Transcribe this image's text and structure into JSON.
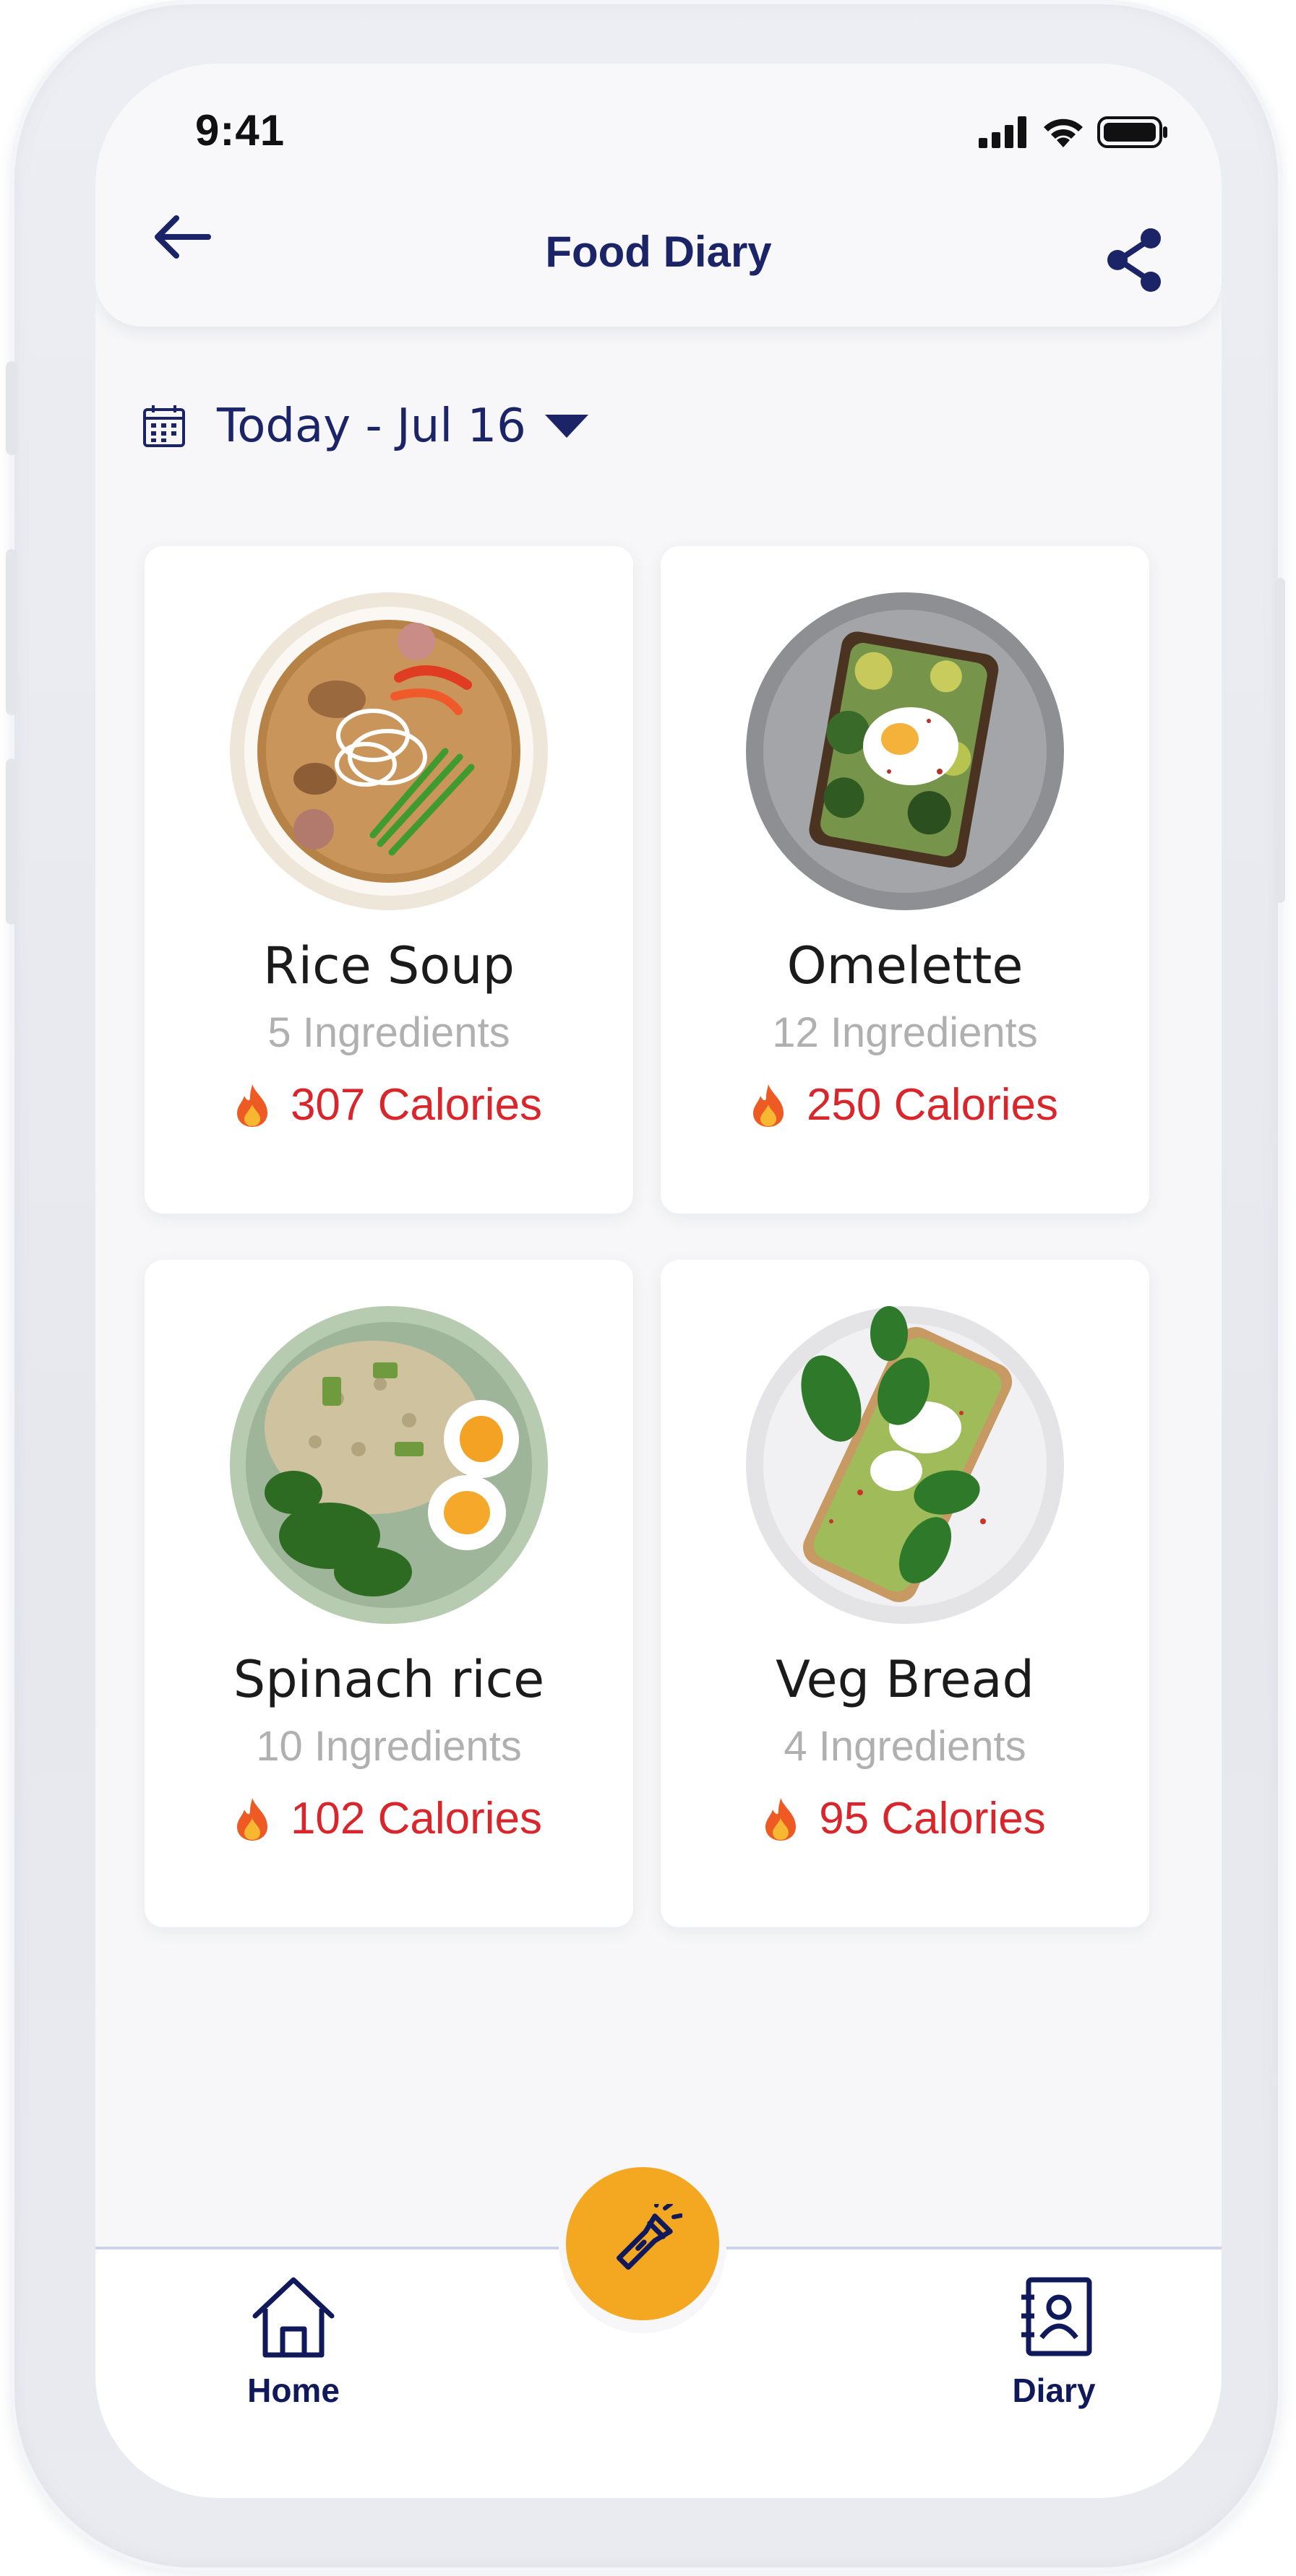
{
  "status_bar": {
    "time": "9:41"
  },
  "header": {
    "title": "Food Diary"
  },
  "date_selector": {
    "label": "Today - Jul 16"
  },
  "meals": [
    {
      "name": "Rice Soup",
      "ingredients": "5 Ingredients",
      "calories": "307 Calories",
      "icon": "rice-soup-plate"
    },
    {
      "name": "Omelette",
      "ingredients": "12 Ingredients",
      "calories": "250 Calories",
      "icon": "avocado-toast-plate"
    },
    {
      "name": "Spinach rice",
      "ingredients": "10 Ingredients",
      "calories": "102 Calories",
      "icon": "rice-egg-plate"
    },
    {
      "name": "Veg Bread",
      "ingredients": "4 Ingredients",
      "calories": "95 Calories",
      "icon": "veg-bread-plate"
    }
  ],
  "bottom_nav": {
    "home_label": "Home",
    "diary_label": "Diary",
    "fab_icon": "flashlight-icon"
  },
  "colors": {
    "primary": "#1a2466",
    "accent": "#f4a821",
    "calories": "#d8262c",
    "muted": "#b0b0b0"
  }
}
